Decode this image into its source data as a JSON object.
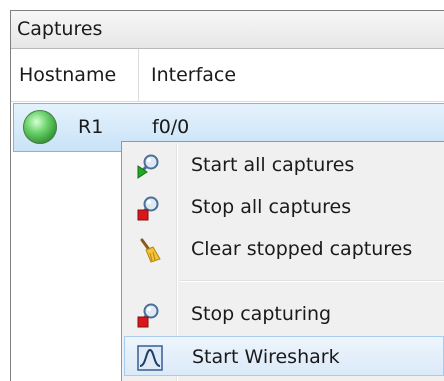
{
  "panel": {
    "title": "Captures"
  },
  "columns": {
    "hostname": "Hostname",
    "interface": "Interface"
  },
  "row": {
    "hostname": "R1",
    "interface": "f0/0",
    "status_color": "#3dbb3d"
  },
  "menu": {
    "items": [
      {
        "label": "Start all captures",
        "icon": "start-capture-icon"
      },
      {
        "label": "Stop all captures",
        "icon": "stop-capture-icon"
      },
      {
        "label": "Clear stopped captures",
        "icon": "broom-icon"
      },
      {
        "label": "Stop capturing",
        "icon": "stop-capture-icon"
      },
      {
        "label": "Start Wireshark",
        "icon": "wireshark-icon"
      }
    ]
  },
  "colors": {
    "selection": "#cce4f7",
    "menu_background": "#f0f0f0",
    "hover_border": "#a8cbef"
  }
}
